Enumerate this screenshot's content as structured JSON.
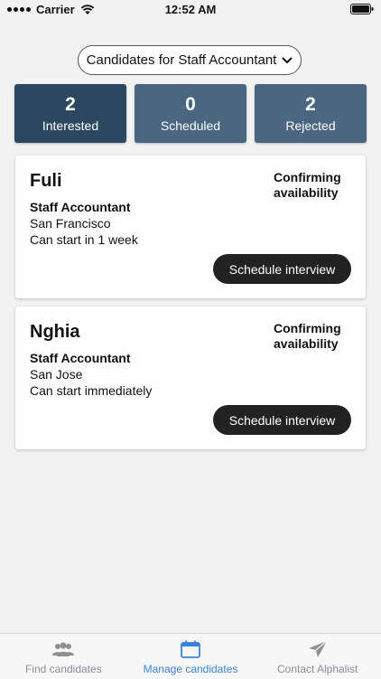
{
  "status_bar": {
    "carrier": "Carrier",
    "time": "12:52 AM"
  },
  "job_selector": {
    "label": "Candidates for Staff Accountant"
  },
  "stats": [
    {
      "count": "2",
      "label": "Interested",
      "active": true
    },
    {
      "count": "0",
      "label": "Scheduled",
      "active": false
    },
    {
      "count": "2",
      "label": "Rejected",
      "active": false
    }
  ],
  "candidates": [
    {
      "name": "Fuli",
      "status": "Confirming availability",
      "title": "Staff Accountant",
      "location": "San Francisco",
      "availability": "Can start in 1 week",
      "action": "Schedule interview"
    },
    {
      "name": "Nghia",
      "status": "Confirming availability",
      "title": "Staff Accountant",
      "location": "San Jose",
      "availability": "Can start immediately",
      "action": "Schedule interview"
    }
  ],
  "tabs": [
    {
      "label": "Find candidates",
      "icon": "people-icon",
      "active": false
    },
    {
      "label": "Manage candidates",
      "icon": "calendar-icon",
      "active": true
    },
    {
      "label": "Contact Alphalist",
      "icon": "send-icon",
      "active": false
    }
  ],
  "colors": {
    "accent": "#3a82d8",
    "stat_active": "#2c4760",
    "stat": "#4a6680",
    "button": "#222222"
  }
}
